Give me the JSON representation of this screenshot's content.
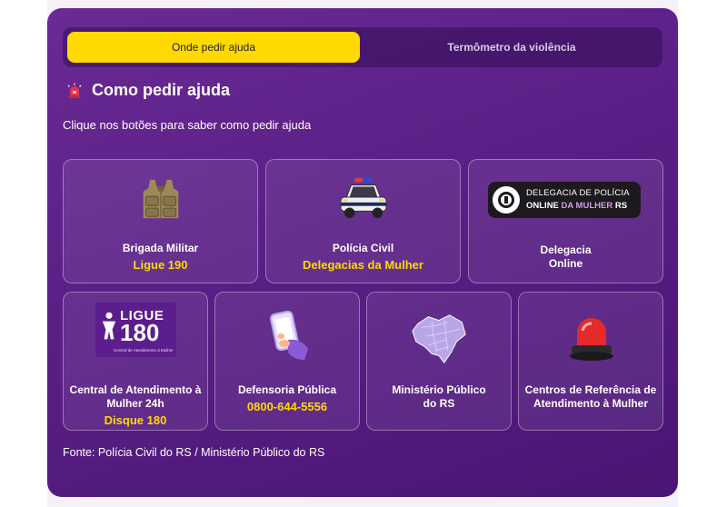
{
  "tabs": [
    {
      "label": "Onde pedir ajuda",
      "active": true
    },
    {
      "label": "Termômetro da violência",
      "active": false
    }
  ],
  "heading": {
    "icon": "siren-icon",
    "title": "Como pedir ajuda"
  },
  "subtitle": "Clique nos botões para saber como pedir ajuda",
  "cards": [
    {
      "title": "Brigada Militar",
      "accent": "Ligue 190",
      "icon": "vest-icon"
    },
    {
      "title": "Polícia Civil",
      "accent": "Delegacias da Mulher",
      "icon": "police-car-icon"
    },
    {
      "title": "Delegacia Online",
      "title_line1": "Delegacia",
      "title_line2": "Online",
      "icon": "delegacia-online-logo",
      "logo": {
        "line1": "DELEGACIA DE POLÍCIA",
        "line2a": "ONLINE",
        "line2b": "DA MULHER",
        "line2c": "RS"
      }
    },
    {
      "title_line1": "Central de Atendimento à",
      "title_line2": "Mulher 24h",
      "accent": "Disque 180",
      "icon": "ligue-180-logo",
      "logo": {
        "word": "LIGUE",
        "number": "180",
        "caption": "Central de Atendimento à Mulher"
      }
    },
    {
      "title": "Defensoria Pública",
      "accent": "0800-644-5556",
      "icon": "phone-icon"
    },
    {
      "title_line1": "Ministério Público",
      "title_line2": "do RS",
      "icon": "rs-map-icon"
    },
    {
      "title_line1": "Centros de Referência de",
      "title_line2": "Atendimento à Mulher",
      "icon": "red-siren-icon"
    }
  ],
  "footer": "Fonte: Polícia Civil do RS / Ministério Público do RS",
  "colors": {
    "panel": "#5a1f86",
    "accent": "#ffd900",
    "tab_active": "#ffd900"
  }
}
